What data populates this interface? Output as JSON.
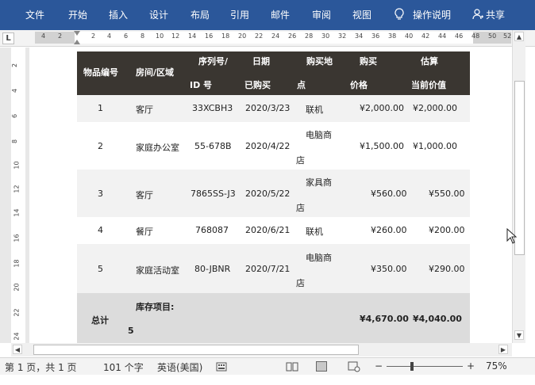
{
  "ribbon": {
    "tabs": [
      "文件",
      "开始",
      "插入",
      "设计",
      "布局",
      "引用",
      "邮件",
      "审阅",
      "视图",
      "操作说明",
      "共享"
    ]
  },
  "ruler": {
    "corner": "L",
    "numbers": [
      "4",
      "2",
      "2",
      "4",
      "6",
      "8",
      "10",
      "12",
      "14",
      "16",
      "18",
      "20",
      "22",
      "24",
      "26",
      "28",
      "30",
      "32",
      "34",
      "36",
      "38",
      "40",
      "42",
      "44",
      "46",
      "48",
      "50",
      "52"
    ],
    "vnumbers": [
      "2",
      "4",
      "6",
      "8",
      "10",
      "12",
      "14",
      "16",
      "18",
      "20",
      "22",
      "24"
    ]
  },
  "table": {
    "headers": {
      "item_no": "物品编号",
      "room": "房间/区域",
      "serial_1": "序列号/",
      "serial_2": "ID 号",
      "date_1": "日期",
      "date_2": "已购买",
      "place_1": "购买地",
      "place_2": "点",
      "price_1": "购买",
      "price_2": "价格",
      "value_1": "估算",
      "value_2": "当前价值"
    },
    "rows": [
      {
        "no": "1",
        "room": "客厅",
        "serial": "33XCBH3",
        "date": "2020/3/23",
        "place_1": "联机",
        "place_2": "",
        "price": "¥2,000.00",
        "value": "¥2,000.00"
      },
      {
        "no": "2",
        "room": "家庭办公室",
        "serial": "55-678B",
        "date": "2020/4/22",
        "place_1": "电脑商",
        "place_2": "店",
        "price": "¥1,500.00",
        "value": "¥1,000.00"
      },
      {
        "no": "3",
        "room": "客厅",
        "serial": "7865SS-J3",
        "date": "2020/5/22",
        "place_1": "家具商",
        "place_2": "店",
        "price": "¥560.00",
        "value": "¥550.00"
      },
      {
        "no": "4",
        "room": "餐厅",
        "serial": "768087",
        "date": "2020/6/21",
        "place_1": "联机",
        "place_2": "",
        "price": "¥260.00",
        "value": "¥200.00"
      },
      {
        "no": "5",
        "room": "家庭活动室",
        "serial": "80-JBNR",
        "date": "2020/7/21",
        "place_1": "电脑商",
        "place_2": "店",
        "price": "¥350.00",
        "value": "¥290.00"
      }
    ],
    "total": {
      "label": "总计",
      "items_label": "库存项目:",
      "items_count": "5",
      "price": "¥4,670.00",
      "value": "¥4,040.00"
    }
  },
  "status": {
    "page": "第 1 页，共 1 页",
    "words": "101 个字",
    "language": "英语(美国)",
    "zoom_minus": "−",
    "zoom_plus": "+",
    "zoom": "75%"
  },
  "icons": {
    "lightbulb": "lightbulb-icon",
    "share": "person-icon"
  }
}
